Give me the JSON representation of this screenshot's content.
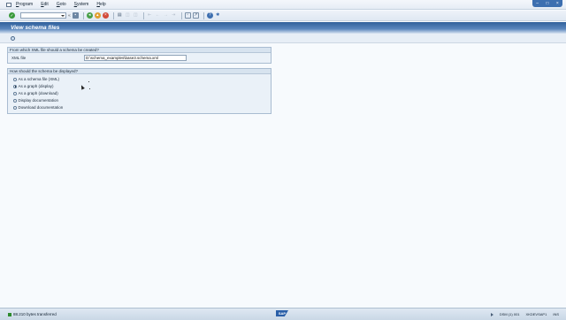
{
  "menu": {
    "items": [
      "Program",
      "Edit",
      "Goto",
      "System",
      "Help"
    ]
  },
  "icons": {
    "toolbar": [
      "save-icon",
      "back-icon",
      "exit-icon",
      "cancel-icon",
      "print-icon",
      "find-icon",
      "find-next-icon",
      "first-page-icon",
      "prev-page-icon",
      "next-page-icon",
      "last-page-icon",
      "new-session-icon",
      "shortcut-icon",
      "help-icon",
      "layout-icon"
    ]
  },
  "title": "View schema files",
  "group1": {
    "title": "From which XML file should a schema be created?",
    "xml_label": "XML file",
    "xml_value": "D:\\schema_examples\\base3.schema.xml"
  },
  "group2": {
    "title": "How should the schema be displayed?",
    "options": [
      {
        "label": "As a schema file (XML)",
        "selected": false
      },
      {
        "label": "As a graph (display)",
        "selected": true
      },
      {
        "label": "As a graph (download)",
        "selected": false
      },
      {
        "label": "Display documentation",
        "selected": false
      },
      {
        "label": "Download documentation",
        "selected": false
      }
    ]
  },
  "status": {
    "message": "88.210 bytes transferred",
    "logo": "SAP",
    "system": "DSM (1) 001",
    "server": "XKDEVSAP1",
    "mode": "INS"
  },
  "colors": {
    "title_bar": "#2f5f9b",
    "background": "#f7fafd",
    "ok_green": "#3a9a3a"
  }
}
